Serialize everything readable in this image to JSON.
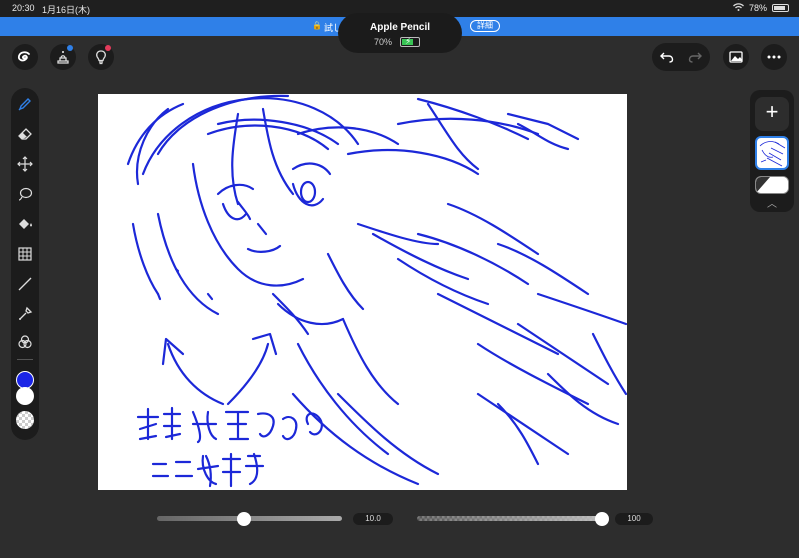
{
  "statusbar": {
    "time": "20:30",
    "date": "1月16日(木)",
    "battery_pct": "78%"
  },
  "notification": {
    "notice_text": "試し",
    "detail_button": "詳細"
  },
  "pencil_popup": {
    "title": "Apple Pencil",
    "battery": "70%",
    "battery_level": 0.7
  },
  "top_toolbar": {
    "left_icons": [
      "app-logo-icon",
      "stamp-icon",
      "lightbulb-icon"
    ],
    "right_icons": [
      "undo-icon",
      "redo-icon",
      "image-icon",
      "more-icon"
    ]
  },
  "left_toolbar": {
    "tools": [
      "pen-icon",
      "eraser-icon",
      "move-icon",
      "lasso-icon",
      "fill-icon",
      "grid-icon",
      "line-icon",
      "eyedropper-icon",
      "blend-icon"
    ],
    "colors": {
      "primary": "#1a24e6",
      "secondary": "#ffffff",
      "transparent": "checker"
    }
  },
  "canvas": {
    "stroke_color": "#1c28d8",
    "handwritten_line1": "村銀河さんの",
    "handwritten_line2": "ここ好き"
  },
  "sliders": {
    "brush_size": "10.0",
    "brush_size_level": 0.47,
    "opacity": "100",
    "opacity_level": 1.0
  },
  "colors": {
    "accent": "#2f80e8",
    "toolbar_bg": "#1c1c1c",
    "app_bg": "#2d2d2d"
  }
}
